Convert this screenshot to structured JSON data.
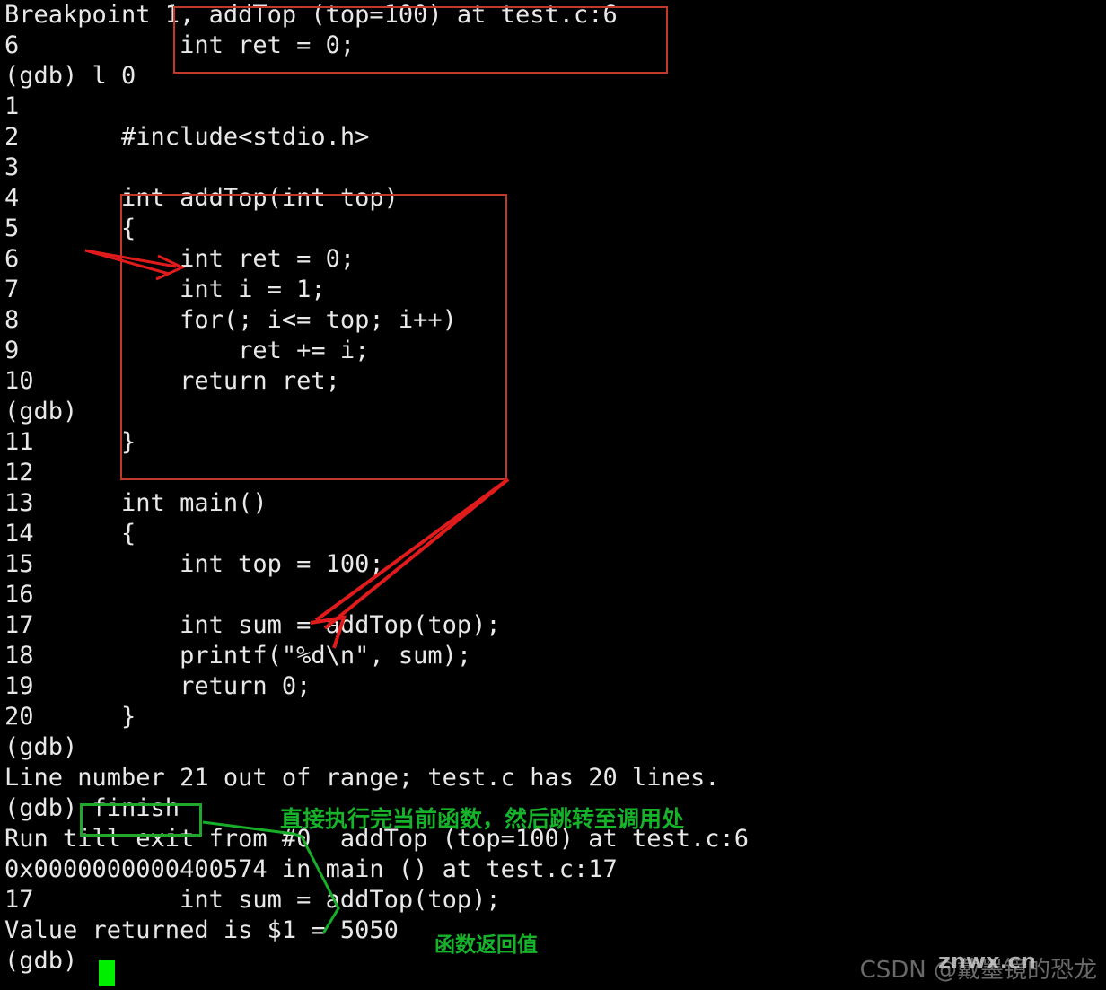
{
  "terminal": {
    "program": "gdb",
    "background_color": "#000000",
    "text_color": "#e8e8e8",
    "cursor_color": "#00ef00",
    "line_height": 34,
    "font_size": 27,
    "lines": [
      {
        "text": "Breakpoint 1, addTop (top=100) at test.c:6"
      },
      {
        "text": "6           int ret = 0;"
      },
      {
        "text": "(gdb) l 0"
      },
      {
        "text": "1"
      },
      {
        "text": "2       #include<stdio.h>"
      },
      {
        "text": "3"
      },
      {
        "text": "4       int addTop(int top)"
      },
      {
        "text": "5       {"
      },
      {
        "text": "6           int ret = 0;"
      },
      {
        "text": "7           int i = 1;"
      },
      {
        "text": "8           for(; i<= top; i++)"
      },
      {
        "text": "9               ret += i;"
      },
      {
        "text": "10          return ret;"
      },
      {
        "text": "(gdb)"
      },
      {
        "text": "11      }"
      },
      {
        "text": "12"
      },
      {
        "text": "13      int main()"
      },
      {
        "text": "14      {"
      },
      {
        "text": "15          int top = 100;"
      },
      {
        "text": "16"
      },
      {
        "text": "17          int sum = addTop(top);"
      },
      {
        "text": "18          printf(\"%d\\n\", sum);"
      },
      {
        "text": "19          return 0;"
      },
      {
        "text": "20      }"
      },
      {
        "text": "(gdb)"
      },
      {
        "text": "Line number 21 out of range; test.c has 20 lines."
      },
      {
        "text": "(gdb) finish"
      },
      {
        "text": "Run till exit from #0  addTop (top=100) at test.c:6"
      },
      {
        "text": "0x0000000000400574 in main () at test.c:17"
      },
      {
        "text": "17          int sum = addTop(top);"
      },
      {
        "text": "Value returned is $1 = 5050"
      },
      {
        "text": "(gdb)"
      }
    ]
  },
  "annotations": {
    "red_color": "#c0392b",
    "green_color": "#16b32a",
    "highlight_box_breakpoint": {
      "label": "breakpoint-location-highlight"
    },
    "highlight_box_function": {
      "label": "addTop-function-highlight"
    },
    "highlight_box_finish": {
      "label": "finish-command-highlight"
    },
    "note_finish": "直接执行完当前函数，然后跳转至调用处",
    "note_return_value": "函数返回值"
  },
  "watermark": {
    "primary": "CSDN @戴墨镜的恐龙",
    "overlay": "znwx.cn"
  }
}
